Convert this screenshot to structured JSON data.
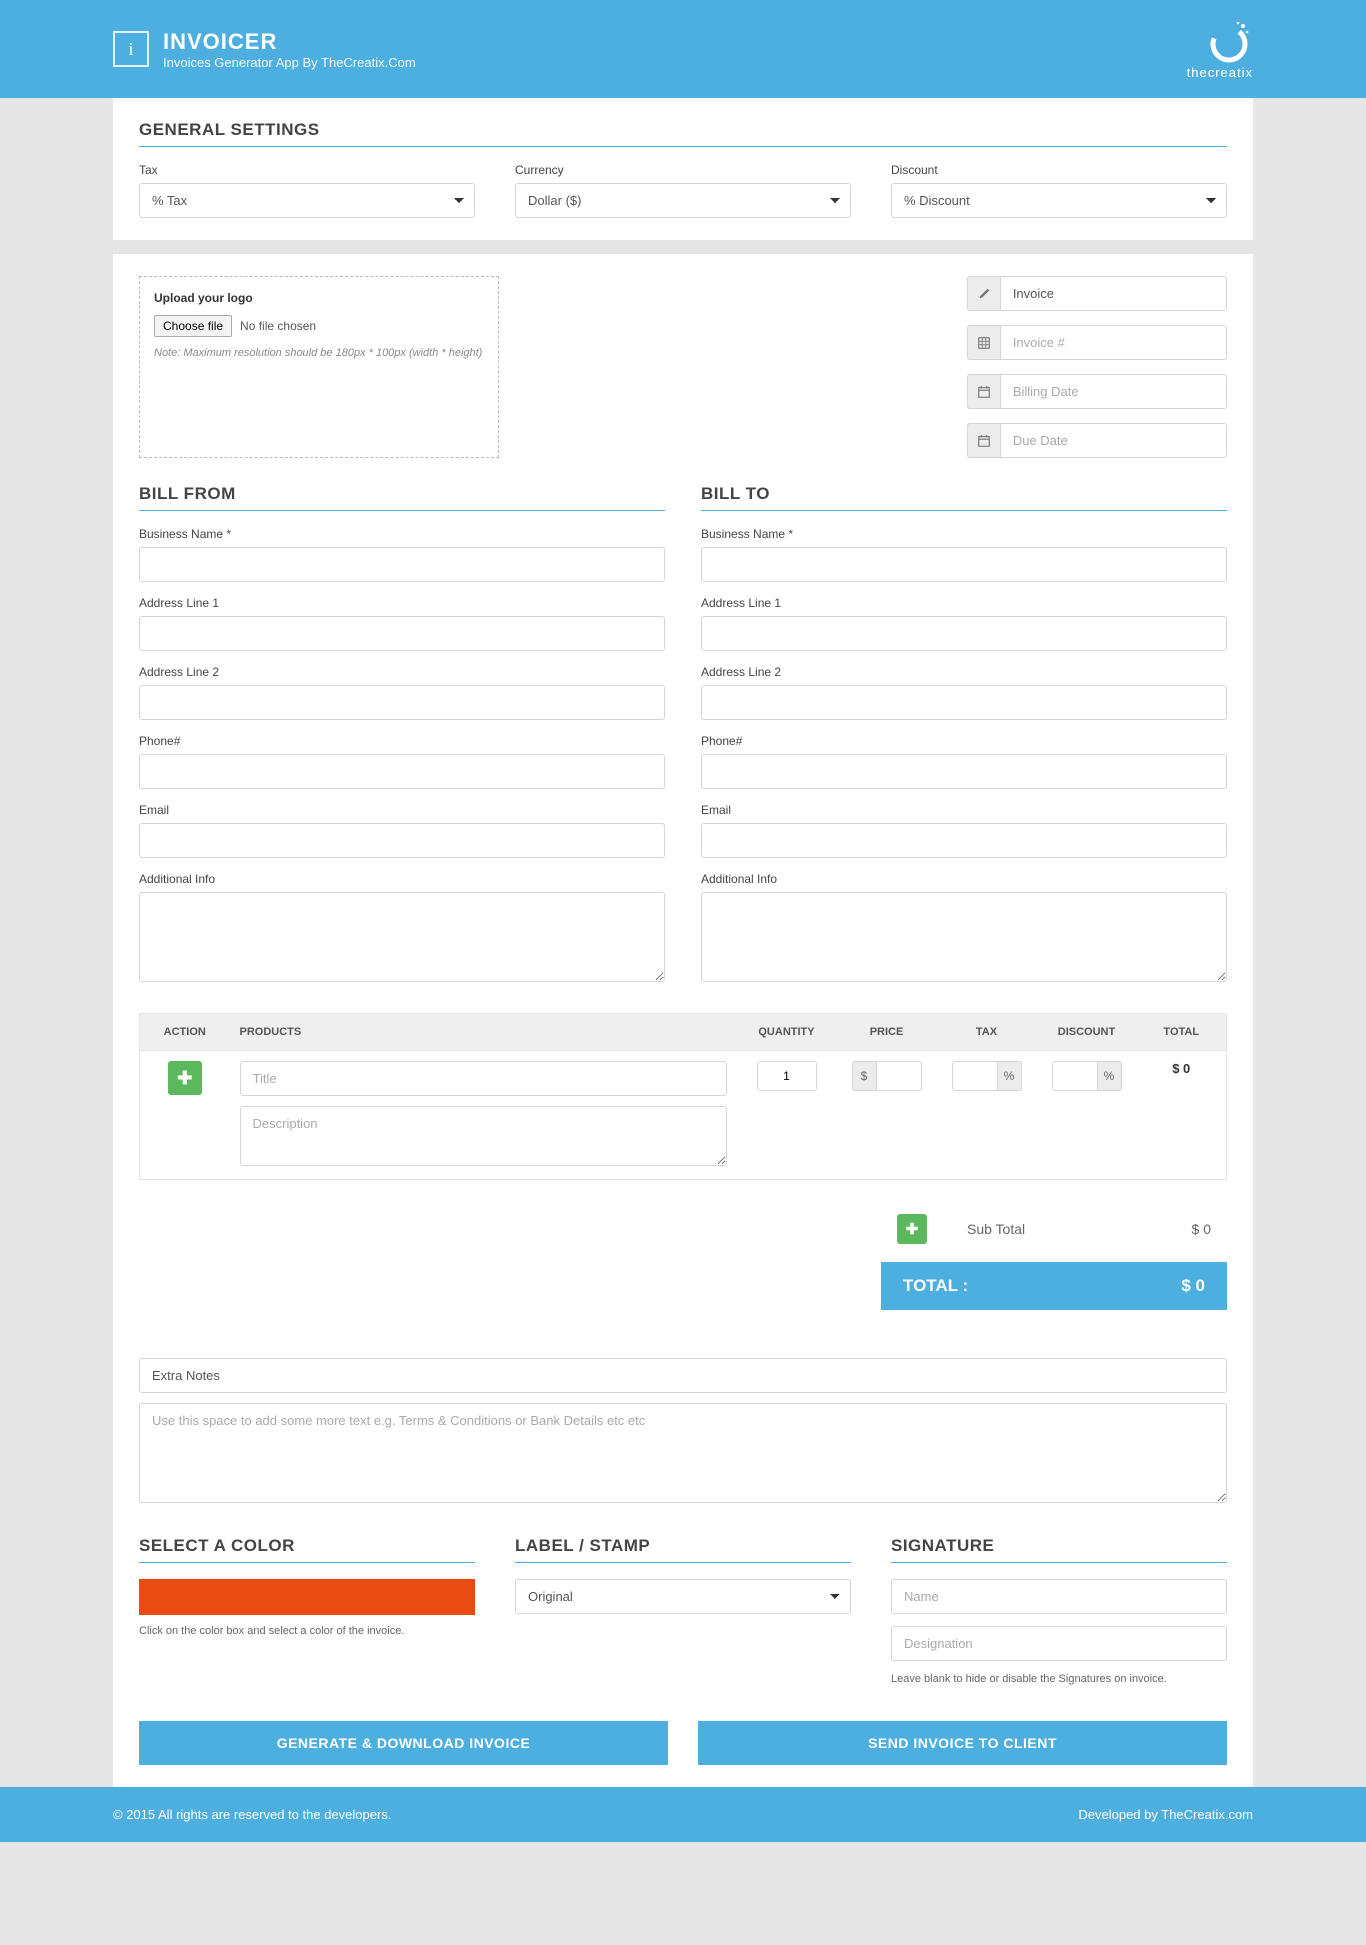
{
  "header": {
    "icon_letter": "i",
    "title": "INVOICER",
    "subtitle": "Invoices Generator App By TheCreatix.Com",
    "right_tag": "thecreatix"
  },
  "general": {
    "title": "GENERAL SETTINGS",
    "tax_label": "Tax",
    "tax_value": "% Tax",
    "currency_label": "Currency",
    "currency_value": "Dollar ($)",
    "discount_label": "Discount",
    "discount_value": "% Discount"
  },
  "upload": {
    "title": "Upload your logo",
    "button": "Choose file",
    "status": "No file chosen",
    "note": "Note: Maximum resolution should be 180px * 100px (width * height)"
  },
  "meta": {
    "invoice_value": "Invoice",
    "number_placeholder": "Invoice #",
    "billing_placeholder": "Billing Date",
    "due_placeholder": "Due Date"
  },
  "bill_from": {
    "title": "BILL FROM",
    "fields": {
      "business": "Business Name *",
      "addr1": "Address Line 1",
      "addr2": "Address Line 2",
      "phone": "Phone#",
      "email": "Email",
      "info": "Additional Info"
    }
  },
  "bill_to": {
    "title": "BILL TO",
    "fields": {
      "business": "Business Name *",
      "addr1": "Address Line 1",
      "addr2": "Address Line 2",
      "phone": "Phone#",
      "email": "Email",
      "info": "Additional Info"
    }
  },
  "items": {
    "headers": {
      "action": "ACTION",
      "products": "PRODUCTS",
      "quantity": "QUANTITY",
      "price": "PRICE",
      "tax": "TAX",
      "discount": "DISCOUNT",
      "total": "TOTAL"
    },
    "row": {
      "title_placeholder": "Title",
      "desc_placeholder": "Description",
      "quantity_value": "1",
      "price_unit": "$",
      "tax_unit": "%",
      "discount_unit": "%",
      "total": "$ 0"
    }
  },
  "totals": {
    "subtotal_label": "Sub Total",
    "subtotal_value": "$ 0",
    "total_label": "TOTAL :",
    "total_value": "$ 0"
  },
  "notes": {
    "title_value": "Extra Notes",
    "body_placeholder": "Use this space to add some more text e.g. Terms & Conditions or Bank Details etc etc"
  },
  "color": {
    "title": "SELECT A COLOR",
    "value": "#e84c12",
    "help": "Click on the color box and select a color of the invoice."
  },
  "stamp": {
    "title": "LABEL / STAMP",
    "value": "Original"
  },
  "signature": {
    "title": "SIGNATURE",
    "name_placeholder": "Name",
    "designation_placeholder": "Designation",
    "help": "Leave blank to hide or disable the Signatures on invoice."
  },
  "actions": {
    "generate": "GENERATE & DOWNLOAD INVOICE",
    "send": "SEND INVOICE TO CLIENT"
  },
  "footer": {
    "left": "© 2015 All rights are reserved to the developers.",
    "right": "Developed by TheCreatix.com"
  }
}
